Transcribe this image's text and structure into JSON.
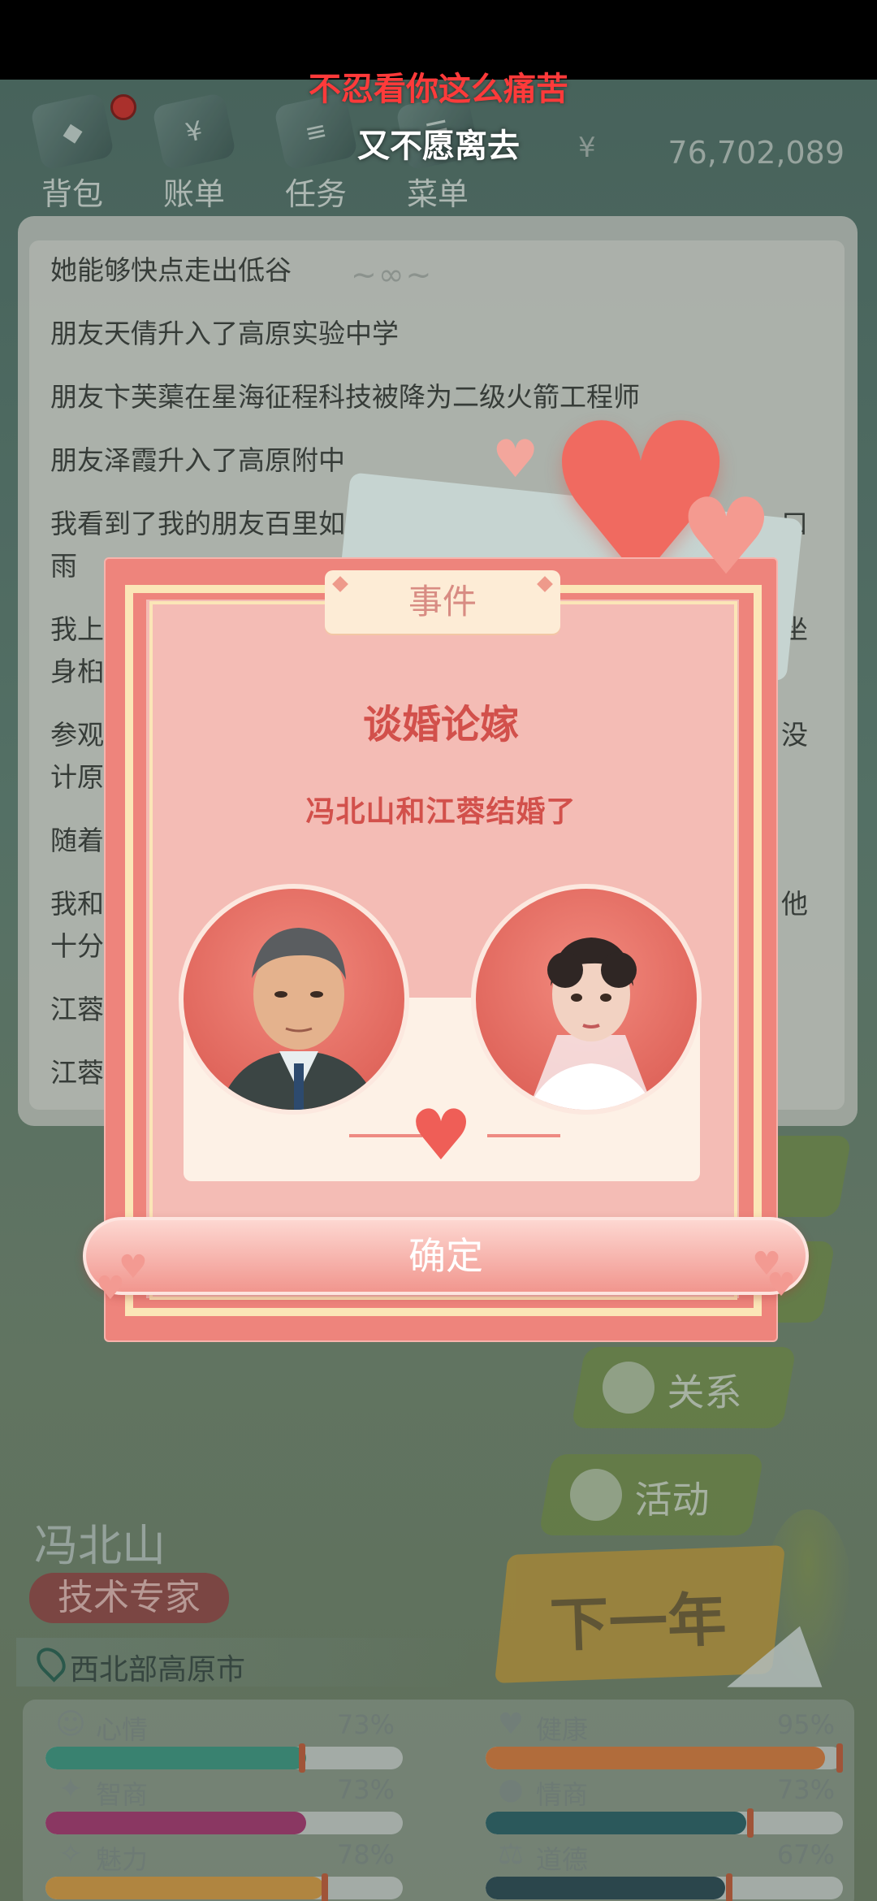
{
  "nav": {
    "items": [
      {
        "label": "背包",
        "icon": "bag-icon"
      },
      {
        "label": "账单",
        "icon": "bill-icon"
      },
      {
        "label": "任务",
        "icon": "task-icon"
      },
      {
        "label": "菜单",
        "icon": "menu-icon"
      }
    ],
    "money_symbol": "¥",
    "money": "76,702,089"
  },
  "subtitles": {
    "line1": "不忍看你这么痛苦",
    "line2": "又不愿离去"
  },
  "log": {
    "lines": [
      "她能够快点走出低谷",
      "朋友天倩升入了高原实验中学",
      "朋友卞芙蕖在星海征程科技被降为二级火箭工程师",
      "朋友泽霞升入了高原附中",
      "我看到了我的朋友百里如",
      "雨",
      "我上",
      "身桕",
      "参观",
      "计原",
      "随着",
      "我和",
      "十分",
      "江蓉",
      "江蓉"
    ],
    "right_fragments": [
      "口",
      "坐",
      "没",
      "他"
    ]
  },
  "modal": {
    "tab": "事件",
    "title": "谈婚论嫁",
    "description": "冯北山和江蓉结婚了",
    "confirm": "确定"
  },
  "side_buttons": {
    "relations": "关系",
    "activities": "活动",
    "next_year": "下一年"
  },
  "character": {
    "name": "冯北山",
    "job": "技术专家",
    "location": "西北部高原市"
  },
  "stats": [
    {
      "name": "心情",
      "value": "73%",
      "percent": 73,
      "icon": "smile-icon",
      "color": "#3f8f7b"
    },
    {
      "name": "健康",
      "value": "95%",
      "percent": 95,
      "icon": "heart-icon",
      "color": "#c8763f"
    },
    {
      "name": "智商",
      "value": "73%",
      "percent": 73,
      "icon": "bulb-icon",
      "color": "#9b3a6c"
    },
    {
      "name": "情商",
      "value": "73%",
      "percent": 73,
      "icon": "apple-icon",
      "color": "#2f5f63"
    },
    {
      "name": "魅力",
      "value": "78%",
      "percent": 78,
      "icon": "sparkle-icon",
      "color": "#c79245"
    },
    {
      "name": "道德",
      "value": "67%",
      "percent": 67,
      "icon": "scale-icon",
      "color": "#2f4a52"
    }
  ]
}
